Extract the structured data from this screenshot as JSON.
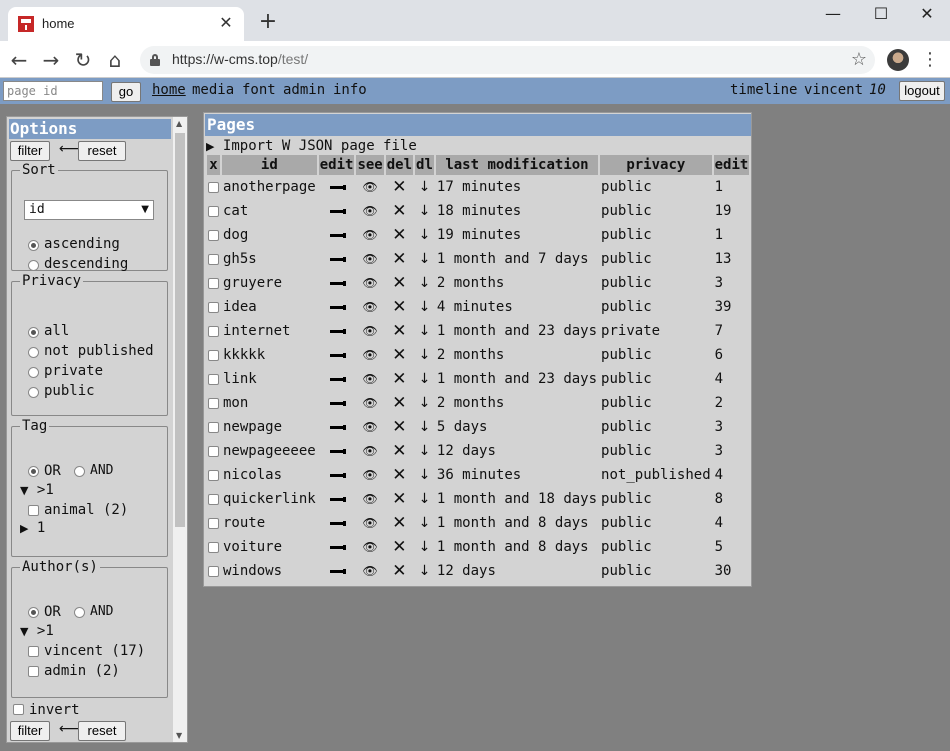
{
  "browser": {
    "tab_title": "home",
    "url_host": "https://w-cms.top",
    "url_path": "/test/",
    "close_glyph": "✕",
    "newtab_glyph": "+",
    "win_min": "—",
    "win_max": "☐",
    "win_close": "✕",
    "back_glyph": "←",
    "forward_glyph": "→",
    "reload_glyph": "↻",
    "home_glyph": "⌂",
    "star_glyph": "☆",
    "menu_glyph": "⋮"
  },
  "sitebar": {
    "page_id_placeholder": "page id",
    "go_label": "go",
    "nav": [
      "home",
      "media",
      "font",
      "admin",
      "info"
    ],
    "timeline": "timeline",
    "user": "vincent",
    "level": "10",
    "logout_label": "logout"
  },
  "options": {
    "title": "Options",
    "filter_label": "filter",
    "reset_label": "reset",
    "arrow_glyph": "⟵",
    "sort": {
      "legend": "Sort",
      "selected": "id",
      "dropdown_glyph": "▼",
      "ascending": "ascending",
      "descending": "descending",
      "checked": "ascending"
    },
    "privacy": {
      "legend": "Privacy",
      "options": [
        "all",
        "not published",
        "private",
        "public"
      ],
      "checked": "all"
    },
    "tag": {
      "legend": "Tag",
      "or_label": "OR",
      "and_label": "AND",
      "checked": "OR",
      "group_open": ">1",
      "items": [
        {
          "label": "animal (2)",
          "checked": false
        }
      ],
      "group_closed": "1",
      "open_glyph": "▼",
      "closed_glyph": "▶"
    },
    "authors": {
      "legend": "Author(s)",
      "or_label": "OR",
      "and_label": "AND",
      "checked": "OR",
      "group_open": ">1",
      "items": [
        {
          "label": "vincent (17)",
          "checked": false
        },
        {
          "label": "admin (2)",
          "checked": false
        }
      ]
    },
    "invert_label": "invert"
  },
  "pages": {
    "title": "Pages",
    "import_label": "Import W JSON page file",
    "import_glyph": "▶",
    "columns": [
      "x",
      "id",
      "edit",
      "see",
      "del",
      "dl",
      "last modification",
      "privacy",
      "edit"
    ],
    "icons": {
      "edit": "pencil-icon",
      "see": "👁",
      "del": "✕",
      "dl": "↓"
    },
    "rows": [
      {
        "id": "anotherpage",
        "modified": "17 minutes",
        "privacy": "public",
        "edits": "1"
      },
      {
        "id": "cat",
        "modified": "18 minutes",
        "privacy": "public",
        "edits": "19"
      },
      {
        "id": "dog",
        "modified": "19 minutes",
        "privacy": "public",
        "edits": "1"
      },
      {
        "id": "gh5s",
        "modified": "1 month and 7 days",
        "privacy": "public",
        "edits": "13"
      },
      {
        "id": "gruyere",
        "modified": "2 months",
        "privacy": "public",
        "edits": "3"
      },
      {
        "id": "idea",
        "modified": "4 minutes",
        "privacy": "public",
        "edits": "39"
      },
      {
        "id": "internet",
        "modified": "1 month and 23 days",
        "privacy": "private",
        "edits": "7"
      },
      {
        "id": "kkkkk",
        "modified": "2 months",
        "privacy": "public",
        "edits": "6"
      },
      {
        "id": "link",
        "modified": "1 month and 23 days",
        "privacy": "public",
        "edits": "4"
      },
      {
        "id": "mon",
        "modified": "2 months",
        "privacy": "public",
        "edits": "2"
      },
      {
        "id": "newpage",
        "modified": "5 days",
        "privacy": "public",
        "edits": "3"
      },
      {
        "id": "newpageeeee",
        "modified": "12 days",
        "privacy": "public",
        "edits": "3"
      },
      {
        "id": "nicolas",
        "modified": "36 minutes",
        "privacy": "not_published",
        "edits": "4"
      },
      {
        "id": "quickerlink",
        "modified": "1 month and 18 days",
        "privacy": "public",
        "edits": "8"
      },
      {
        "id": "route",
        "modified": "1 month and 8 days",
        "privacy": "public",
        "edits": "4"
      },
      {
        "id": "voiture",
        "modified": "1 month and 8 days",
        "privacy": "public",
        "edits": "5"
      },
      {
        "id": "windows",
        "modified": "12 days",
        "privacy": "public",
        "edits": "30"
      }
    ]
  }
}
